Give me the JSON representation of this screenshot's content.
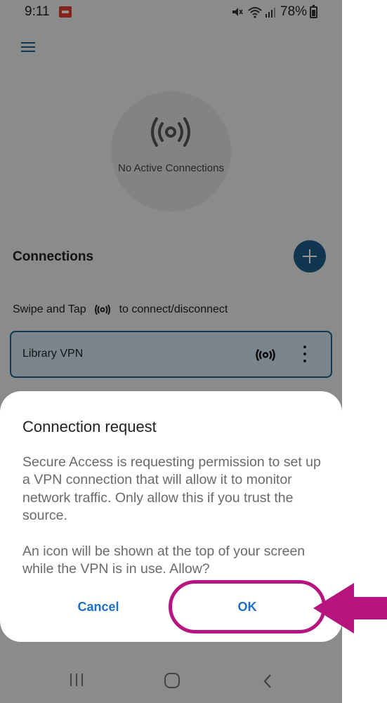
{
  "status_bar": {
    "time": "9:11",
    "battery_pct": "78%",
    "icons": [
      "notification-icon",
      "mute-icon",
      "wifi-icon",
      "signal-icon",
      "battery-icon"
    ]
  },
  "app": {
    "status_circle_text": "No Active Connections",
    "connections_title": "Connections",
    "swipe_hint_before": "Swipe and Tap",
    "swipe_hint_after": "to connect/disconnect",
    "connection_item": {
      "name": "Library VPN"
    },
    "accent_color": "#1c5f88"
  },
  "dialog": {
    "title": "Connection request",
    "paragraph1": "Secure Access is requesting permission to set up a VPN connection that will allow it to monitor network traffic. Only allow this if you trust the source.",
    "paragraph2": "An icon will be shown at the top of your screen while the VPN is in use. Allow?",
    "cancel_label": "Cancel",
    "ok_label": "OK",
    "button_color": "#1f6fc4"
  },
  "annotation": {
    "highlight_color": "#b6147e",
    "target": "ok-button"
  },
  "nav_bar": {
    "icons": [
      "recents-icon",
      "home-icon",
      "back-icon"
    ]
  }
}
